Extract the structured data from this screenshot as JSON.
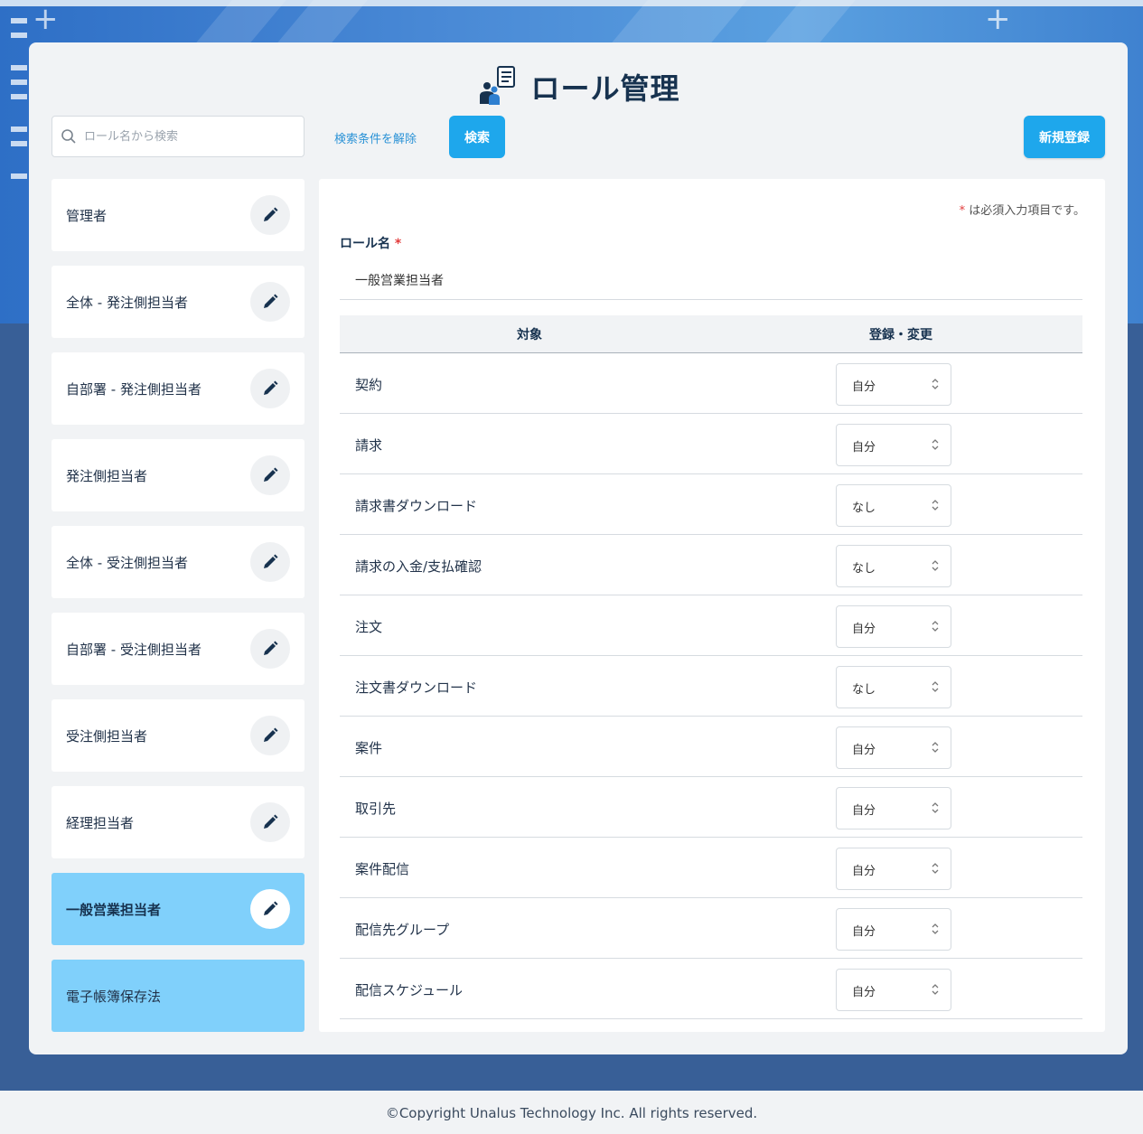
{
  "header": {
    "title": "ロール管理",
    "icon": "role-management-icon"
  },
  "search": {
    "placeholder": "ロール名から検索",
    "clear_label": "検索条件を解除",
    "button_label": "検索"
  },
  "new_button_label": "新規登録",
  "roles": [
    {
      "label": "管理者",
      "editable": true,
      "selected": false
    },
    {
      "label": "全体 - 発注側担当者",
      "editable": true,
      "selected": false
    },
    {
      "label": "自部署 - 発注側担当者",
      "editable": true,
      "selected": false
    },
    {
      "label": "発注側担当者",
      "editable": true,
      "selected": false
    },
    {
      "label": "全体 - 受注側担当者",
      "editable": true,
      "selected": false
    },
    {
      "label": "自部署 - 受注側担当者",
      "editable": true,
      "selected": false
    },
    {
      "label": "受注側担当者",
      "editable": true,
      "selected": false
    },
    {
      "label": "経理担当者",
      "editable": true,
      "selected": false
    },
    {
      "label": "一般営業担当者",
      "editable": true,
      "selected": true
    },
    {
      "label": "電子帳簿保存法",
      "editable": false,
      "selected": false
    }
  ],
  "form": {
    "required_mark": "*",
    "required_note": "は必須入力項目です。",
    "role_name_label": "ロール名",
    "role_name_value": "一般営業担当者"
  },
  "table": {
    "headers": [
      "対象",
      "登録・変更"
    ],
    "rows": [
      {
        "target": "契約",
        "permission": "自分"
      },
      {
        "target": "請求",
        "permission": "自分"
      },
      {
        "target": "請求書ダウンロード",
        "permission": "なし"
      },
      {
        "target": "請求の入金/支払確認",
        "permission": "なし"
      },
      {
        "target": "注文",
        "permission": "自分"
      },
      {
        "target": "注文書ダウンロード",
        "permission": "なし"
      },
      {
        "target": "案件",
        "permission": "自分"
      },
      {
        "target": "取引先",
        "permission": "自分"
      },
      {
        "target": "案件配信",
        "permission": "自分"
      },
      {
        "target": "配信先グループ",
        "permission": "自分"
      },
      {
        "target": "配信スケジュール",
        "permission": "自分"
      }
    ]
  },
  "footer": {
    "copyright": "©Copyright Unalus Technology Inc. All rights reserved."
  },
  "colors": {
    "accent": "#1ea7ec",
    "selected_item": "#80d0fb",
    "title": "#17324f",
    "required": "#e23b3b",
    "background": "#385f97"
  }
}
